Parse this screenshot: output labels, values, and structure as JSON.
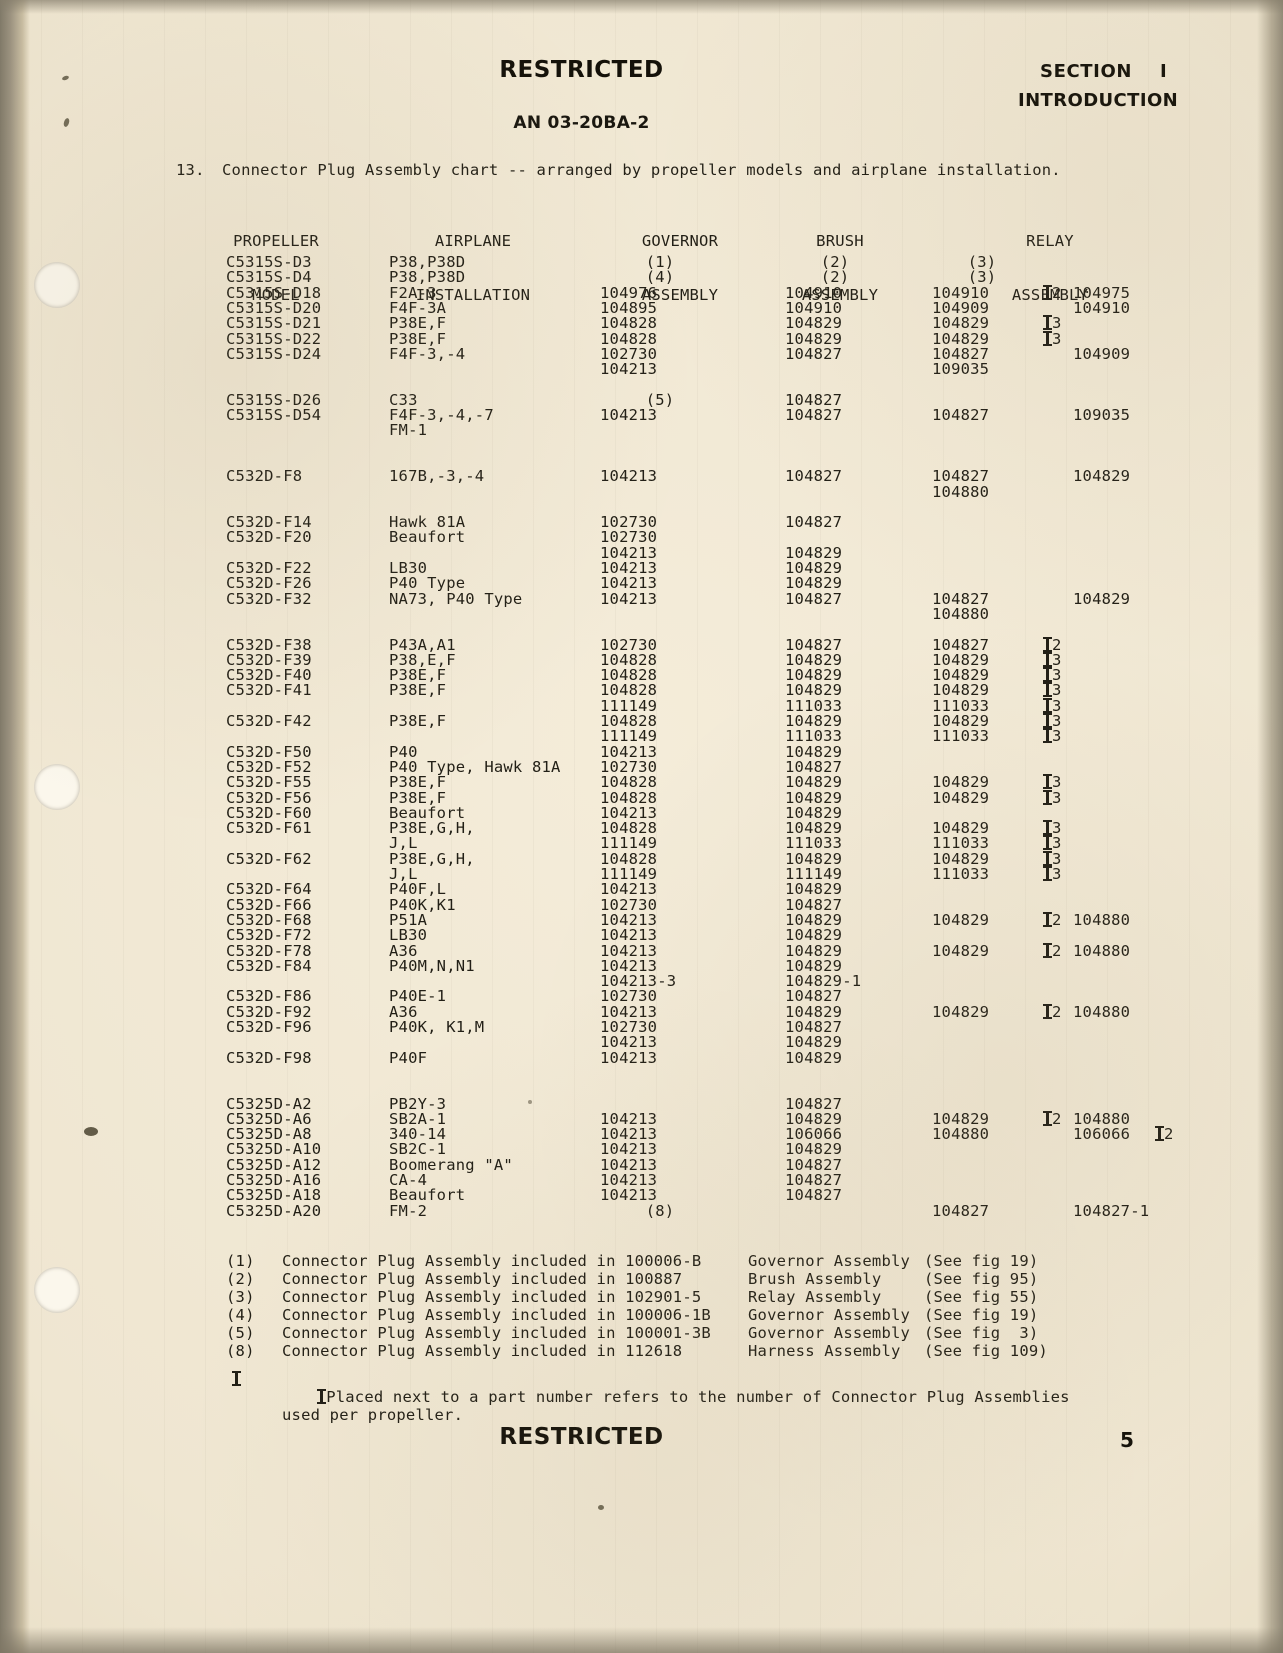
{
  "page": {
    "classification_top": "RESTRICTED",
    "classification_bottom": "RESTRICTED",
    "doc_number": "AN 03-20BA-2",
    "section_label": "SECTION",
    "section_number": "I",
    "section_title": "INTRODUCTION",
    "page_number": "5"
  },
  "intro": {
    "item_number": "13.",
    "text": "Connector Plug Assembly chart -- arranged by propeller models and airplane installation."
  },
  "columns": [
    {
      "line1": "PROPELLER",
      "line2": "MODEL"
    },
    {
      "line1": "AIRPLANE",
      "line2": "INSTALLATION"
    },
    {
      "line1": "GOVERNOR",
      "line2": "ASSEMBLY"
    },
    {
      "line1": "BRUSH",
      "line2": "ASSEMBLY"
    },
    {
      "line1": "RELAY",
      "line2": "ASSEMBLY"
    }
  ],
  "rows": [
    {
      "model": "C5315S-D3",
      "airplane": "P38,P38D",
      "governor": "(1)",
      "governor_paren": true,
      "brush": "(2)",
      "brush_paren": true,
      "relay1": "(3)",
      "relay_paren": true,
      "dagger": "",
      "relay2": ""
    },
    {
      "model": "C5315S-D4",
      "airplane": "P38,P38D",
      "governor": "(4)",
      "governor_paren": true,
      "brush": "(2)",
      "brush_paren": true,
      "relay1": "(3)",
      "relay_paren": true,
      "dagger": "",
      "relay2": ""
    },
    {
      "model": "C5315S-D18",
      "airplane": "F2A-3",
      "governor": "104976",
      "brush": "104910",
      "relay1": "104910",
      "dagger": "2",
      "relay2": "104975"
    },
    {
      "model": "C5315S-D20",
      "airplane": "F4F-3A",
      "governor": "104895",
      "brush": "104910",
      "relay1": "104909",
      "dagger": "",
      "relay2": "104910"
    },
    {
      "model": "C5315S-D21",
      "airplane": "P38E,F",
      "governor": "104828",
      "brush": "104829",
      "relay1": "104829",
      "dagger": "3",
      "relay2": ""
    },
    {
      "model": "C5315S-D22",
      "airplane": "P38E,F",
      "governor": "104828",
      "brush": "104829",
      "relay1": "104829",
      "dagger": "3",
      "relay2": ""
    },
    {
      "model": "C5315S-D24",
      "airplane": "F4F-3,-4",
      "governor": "102730",
      "brush": "104827",
      "relay1": "104827",
      "dagger": "",
      "relay2": "104909"
    },
    {
      "model": "",
      "airplane": "",
      "governor": "104213",
      "brush": "",
      "relay1": "109035",
      "dagger": "",
      "relay2": ""
    },
    {
      "model": "",
      "airplane": "",
      "governor": "",
      "brush": "",
      "relay1": "",
      "dagger": "",
      "relay2": ""
    },
    {
      "model": "C5315S-D26",
      "airplane": "C33",
      "governor": "(5)",
      "governor_paren": true,
      "brush": "104827",
      "relay1": "",
      "dagger": "",
      "relay2": ""
    },
    {
      "model": "C5315S-D54",
      "airplane": "F4F-3,-4,-7",
      "governor": "104213",
      "brush": "104827",
      "relay1": "104827",
      "dagger": "",
      "relay2": "109035"
    },
    {
      "model": "",
      "airplane": "FM-1",
      "governor": "",
      "brush": "",
      "relay1": "",
      "dagger": "",
      "relay2": ""
    },
    {
      "model": "",
      "airplane": "",
      "governor": "",
      "brush": "",
      "relay1": "",
      "dagger": "",
      "relay2": ""
    },
    {
      "model": "",
      "airplane": "",
      "governor": "",
      "brush": "",
      "relay1": "",
      "dagger": "",
      "relay2": ""
    },
    {
      "model": "C532D-F8",
      "airplane": "167B,-3,-4",
      "governor": "104213",
      "brush": "104827",
      "relay1": "104827",
      "dagger": "",
      "relay2": "104829"
    },
    {
      "model": "",
      "airplane": "",
      "governor": "",
      "brush": "",
      "relay1": "104880",
      "dagger": "",
      "relay2": ""
    },
    {
      "model": "",
      "airplane": "",
      "governor": "",
      "brush": "",
      "relay1": "",
      "dagger": "",
      "relay2": ""
    },
    {
      "model": "C532D-F14",
      "airplane": "Hawk 81A",
      "governor": "102730",
      "brush": "104827",
      "relay1": "",
      "dagger": "",
      "relay2": ""
    },
    {
      "model": "C532D-F20",
      "airplane": "Beaufort",
      "governor": "102730",
      "brush": "",
      "relay1": "",
      "dagger": "",
      "relay2": ""
    },
    {
      "model": "",
      "airplane": "",
      "governor": "104213",
      "brush": "104829",
      "relay1": "",
      "dagger": "",
      "relay2": ""
    },
    {
      "model": "C532D-F22",
      "airplane": "LB30",
      "governor": "104213",
      "brush": "104829",
      "relay1": "",
      "dagger": "",
      "relay2": ""
    },
    {
      "model": "C532D-F26",
      "airplane": "P40 Type",
      "governor": "104213",
      "brush": "104829",
      "relay1": "",
      "dagger": "",
      "relay2": ""
    },
    {
      "model": "C532D-F32",
      "airplane": "NA73, P40 Type",
      "governor": "104213",
      "brush": "104827",
      "relay1": "104827",
      "dagger": "",
      "relay2": "104829"
    },
    {
      "model": "",
      "airplane": "",
      "governor": "",
      "brush": "",
      "relay1": "104880",
      "dagger": "",
      "relay2": ""
    },
    {
      "model": "",
      "airplane": "",
      "governor": "",
      "brush": "",
      "relay1": "",
      "dagger": "",
      "relay2": ""
    },
    {
      "model": "C532D-F38",
      "airplane": "P43A,A1",
      "governor": "102730",
      "brush": "104827",
      "relay1": "104827",
      "dagger": "2",
      "relay2": ""
    },
    {
      "model": "C532D-F39",
      "airplane": "P38,E,F",
      "governor": "104828",
      "brush": "104829",
      "relay1": "104829",
      "dagger": "3",
      "relay2": ""
    },
    {
      "model": "C532D-F40",
      "airplane": "P38E,F",
      "governor": "104828",
      "brush": "104829",
      "relay1": "104829",
      "dagger": "3",
      "relay2": ""
    },
    {
      "model": "C532D-F41",
      "airplane": "P38E,F",
      "governor": "104828",
      "brush": "104829",
      "relay1": "104829",
      "dagger": "3",
      "relay2": ""
    },
    {
      "model": "",
      "airplane": "",
      "governor": "111149",
      "brush": "111033",
      "relay1": "111033",
      "dagger": "3",
      "relay2": ""
    },
    {
      "model": "C532D-F42",
      "airplane": "P38E,F",
      "governor": "104828",
      "brush": "104829",
      "relay1": "104829",
      "dagger": "3",
      "relay2": ""
    },
    {
      "model": "",
      "airplane": "",
      "governor": "111149",
      "brush": "111033",
      "relay1": "111033",
      "dagger": "3",
      "relay2": ""
    },
    {
      "model": "C532D-F50",
      "airplane": "P40",
      "governor": "104213",
      "brush": "104829",
      "relay1": "",
      "dagger": "",
      "relay2": ""
    },
    {
      "model": "C532D-F52",
      "airplane": "P40 Type, Hawk 81A",
      "governor": "102730",
      "brush": "104827",
      "relay1": "",
      "dagger": "",
      "relay2": ""
    },
    {
      "model": "C532D-F55",
      "airplane": "P38E,F",
      "governor": "104828",
      "brush": "104829",
      "relay1": "104829",
      "dagger": "3",
      "relay2": ""
    },
    {
      "model": "C532D-F56",
      "airplane": "P38E,F",
      "governor": "104828",
      "brush": "104829",
      "relay1": "104829",
      "dagger": "3",
      "relay2": ""
    },
    {
      "model": "C532D-F60",
      "airplane": "Beaufort",
      "governor": "104213",
      "brush": "104829",
      "relay1": "",
      "dagger": "",
      "relay2": ""
    },
    {
      "model": "C532D-F61",
      "airplane": "P38E,G,H,",
      "governor": "104828",
      "brush": "104829",
      "relay1": "104829",
      "dagger": "3",
      "relay2": ""
    },
    {
      "model": "",
      "airplane": "J,L",
      "governor": "111149",
      "brush": "111033",
      "relay1": "111033",
      "dagger": "3",
      "relay2": ""
    },
    {
      "model": "C532D-F62",
      "airplane": "P38E,G,H,",
      "governor": "104828",
      "brush": "104829",
      "relay1": "104829",
      "dagger": "3",
      "relay2": ""
    },
    {
      "model": "",
      "airplane": "J,L",
      "governor": "111149",
      "brush": "111149",
      "relay1": "111033",
      "dagger": "3",
      "relay2": ""
    },
    {
      "model": "C532D-F64",
      "airplane": "P40F,L",
      "governor": "104213",
      "brush": "104829",
      "relay1": "",
      "dagger": "",
      "relay2": ""
    },
    {
      "model": "C532D-F66",
      "airplane": "P40K,K1",
      "governor": "102730",
      "brush": "104827",
      "relay1": "",
      "dagger": "",
      "relay2": ""
    },
    {
      "model": "C532D-F68",
      "airplane": "P51A",
      "governor": "104213",
      "brush": "104829",
      "relay1": "104829",
      "dagger": "2",
      "relay2": "104880"
    },
    {
      "model": "C532D-F72",
      "airplane": "LB30",
      "governor": "104213",
      "brush": "104829",
      "relay1": "",
      "dagger": "",
      "relay2": ""
    },
    {
      "model": "C532D-F78",
      "airplane": "A36",
      "governor": "104213",
      "brush": "104829",
      "relay1": "104829",
      "dagger": "2",
      "relay2": "104880"
    },
    {
      "model": "C532D-F84",
      "airplane": "P40M,N,N1",
      "governor": "104213",
      "brush": "104829",
      "relay1": "",
      "dagger": "",
      "relay2": ""
    },
    {
      "model": "",
      "airplane": "",
      "governor": "104213-3",
      "brush": "104829-1",
      "relay1": "",
      "dagger": "",
      "relay2": ""
    },
    {
      "model": "C532D-F86",
      "airplane": "P40E-1",
      "governor": "102730",
      "brush": "104827",
      "relay1": "",
      "dagger": "",
      "relay2": ""
    },
    {
      "model": "C532D-F92",
      "airplane": "A36",
      "governor": "104213",
      "brush": "104829",
      "relay1": "104829",
      "dagger": "2",
      "relay2": "104880"
    },
    {
      "model": "C532D-F96",
      "airplane": "P40K, K1,M",
      "governor": "102730",
      "brush": "104827",
      "relay1": "",
      "dagger": "",
      "relay2": ""
    },
    {
      "model": "",
      "airplane": "",
      "governor": "104213",
      "brush": "104829",
      "relay1": "",
      "dagger": "",
      "relay2": ""
    },
    {
      "model": "C532D-F98",
      "airplane": "P40F",
      "governor": "104213",
      "brush": "104829",
      "relay1": "",
      "dagger": "",
      "relay2": ""
    },
    {
      "model": "",
      "airplane": "",
      "governor": "",
      "brush": "",
      "relay1": "",
      "dagger": "",
      "relay2": ""
    },
    {
      "model": "",
      "airplane": "",
      "governor": "",
      "brush": "",
      "relay1": "",
      "dagger": "",
      "relay2": ""
    },
    {
      "model": "C5325D-A2",
      "airplane": "PB2Y-3",
      "governor": "",
      "brush": "104827",
      "relay1": "",
      "dagger": "",
      "relay2": ""
    },
    {
      "model": "C5325D-A6",
      "airplane": "SB2A-1",
      "governor": "104213",
      "brush": "104829",
      "relay1": "104829",
      "dagger": "2",
      "relay2": "104880"
    },
    {
      "model": "C5325D-A8",
      "airplane": "340-14",
      "governor": "104213",
      "brush": "106066",
      "relay1": "104880",
      "dagger": "",
      "relay2": "106066",
      "dagger2": "2"
    },
    {
      "model": "C5325D-A10",
      "airplane": "SB2C-1",
      "governor": "104213",
      "brush": "104829",
      "relay1": "",
      "dagger": "",
      "relay2": ""
    },
    {
      "model": "C5325D-A12",
      "airplane": "Boomerang \"A\"",
      "governor": "104213",
      "brush": "104827",
      "relay1": "",
      "dagger": "",
      "relay2": ""
    },
    {
      "model": "C5325D-A16",
      "airplane": "CA-4",
      "governor": "104213",
      "brush": "104827",
      "relay1": "",
      "dagger": "",
      "relay2": ""
    },
    {
      "model": "C5325D-A18",
      "airplane": "Beaufort",
      "governor": "104213",
      "brush": "104827",
      "relay1": "",
      "dagger": "",
      "relay2": ""
    },
    {
      "model": "C5325D-A20",
      "airplane": "FM-2",
      "governor": "(8)",
      "governor_paren": true,
      "brush": "",
      "relay1": "104827",
      "dagger": "",
      "relay2": "104827-1"
    }
  ],
  "footnotes": [
    {
      "mark": "(1)",
      "text": "Connector Plug Assembly included in 100006-B",
      "assembly": "Governor Assembly",
      "figure": "(See fig 19)"
    },
    {
      "mark": "(2)",
      "text": "Connector Plug Assembly included in 100887",
      "assembly": "Brush Assembly",
      "figure": "(See fig 95)"
    },
    {
      "mark": "(3)",
      "text": "Connector Plug Assembly included in 102901-5",
      "assembly": "Relay Assembly",
      "figure": "(See fig 55)"
    },
    {
      "mark": "(4)",
      "text": "Connector Plug Assembly included in 100006-1B",
      "assembly": "Governor Assembly",
      "figure": "(See fig 19)"
    },
    {
      "mark": "(5)",
      "text": "Connector Plug Assembly included in 100001-3B",
      "assembly": "Governor Assembly",
      "figure": "(See fig  3)"
    },
    {
      "mark": "(8)",
      "text": "Connector Plug Assembly included in 112618",
      "assembly": "Harness Assembly",
      "figure": "(See fig 109)"
    }
  ],
  "dagger_note": {
    "line1": "Placed next to a part number refers to the number of Connector Plug Assemblies",
    "line2": "used per propeller."
  }
}
